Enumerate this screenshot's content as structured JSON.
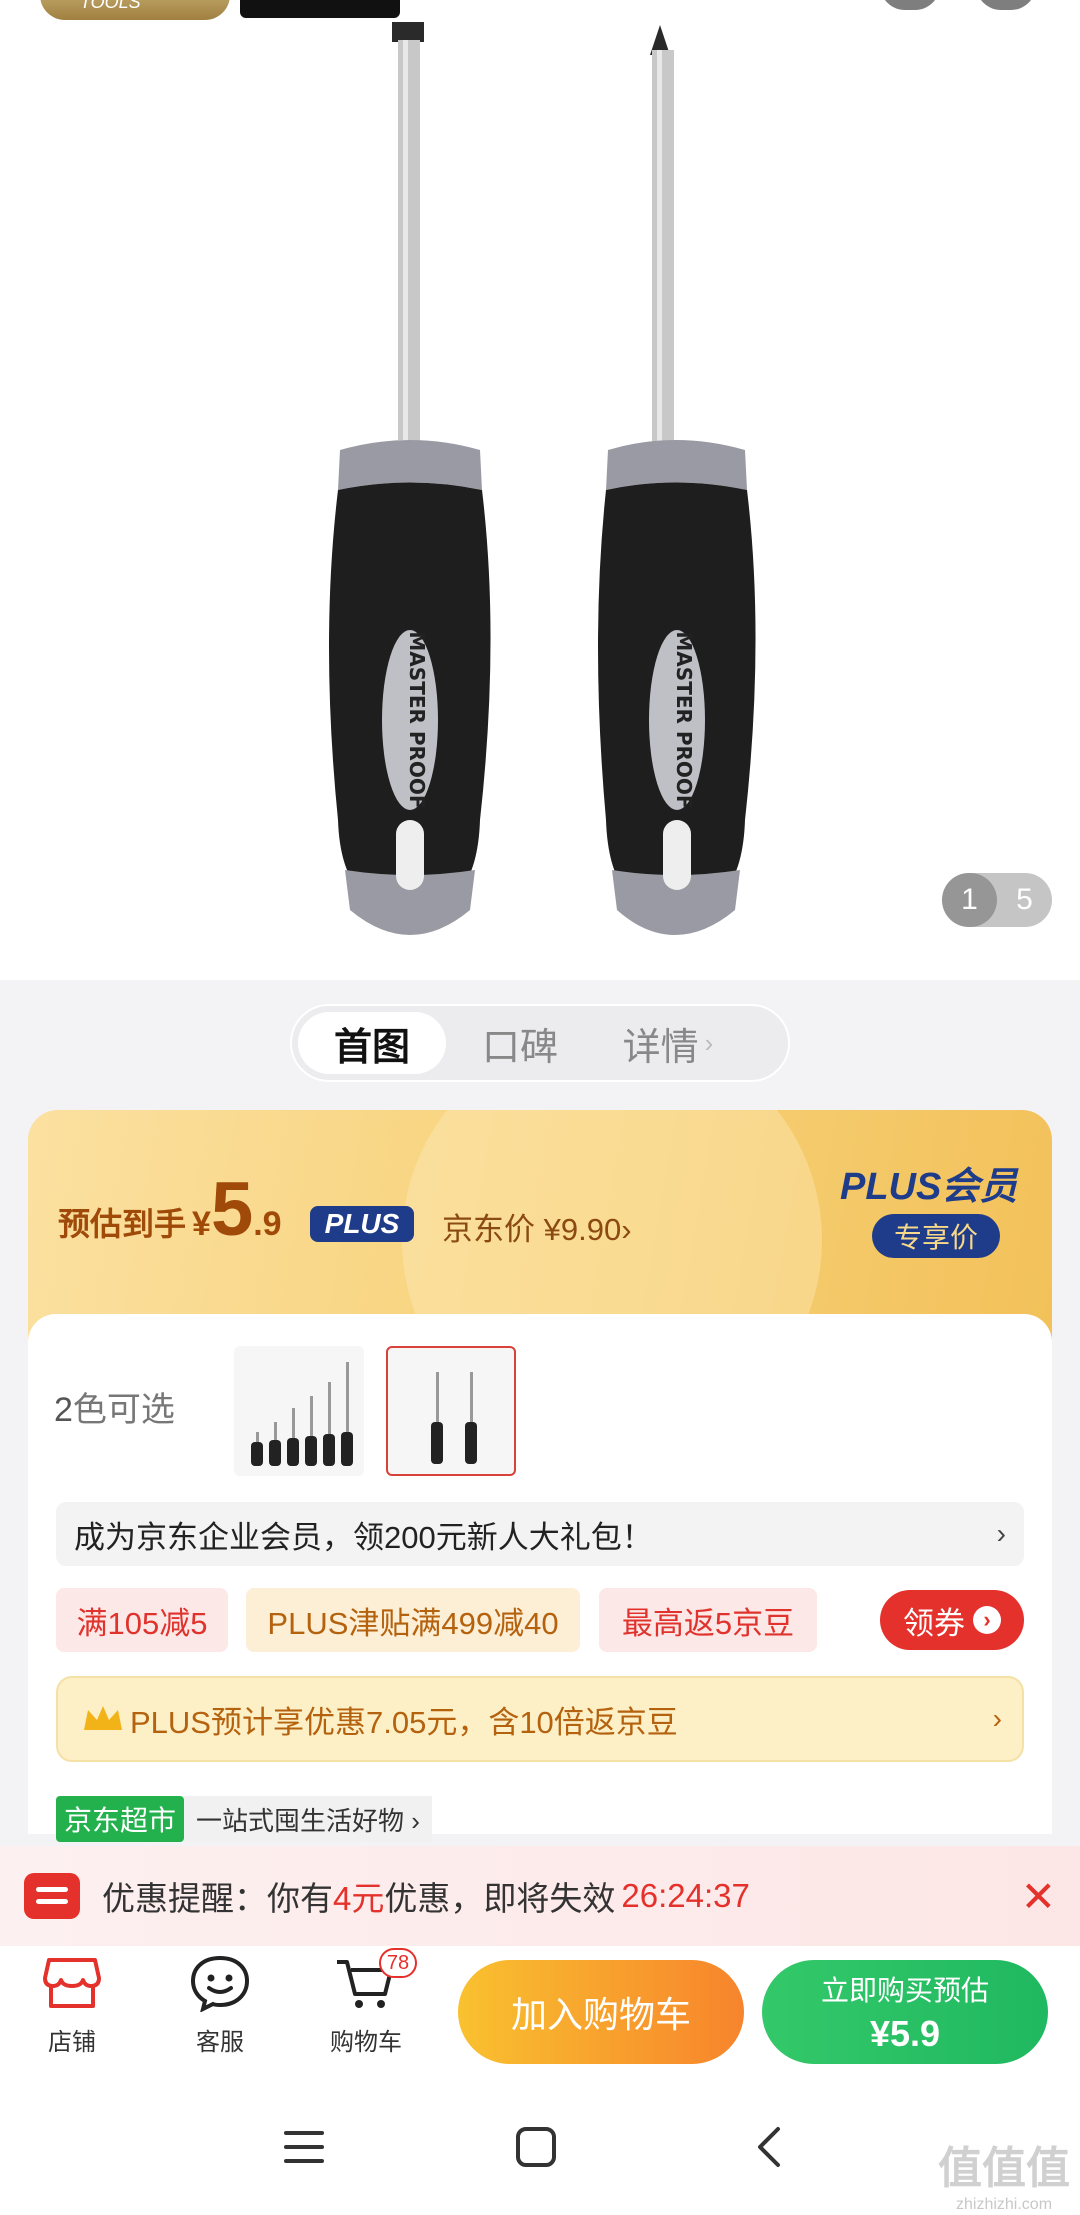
{
  "gallery": {
    "current_page": "1",
    "total_pages": "5",
    "handle_text": "MASTER PROOF"
  },
  "tabs": [
    {
      "label": "首图",
      "active": true
    },
    {
      "label": "口碑",
      "active": false
    },
    {
      "label": "详情",
      "active": false
    }
  ],
  "price": {
    "estimate_label": "预估到手",
    "currency": "¥",
    "integer": "5",
    "decimal": ".9",
    "plus_chip": "PLUS",
    "jd_price": "京东价 ¥9.90›",
    "plus_member_title": "PLUS会员",
    "exclusive_label": "专享价"
  },
  "variants": {
    "label_count": "2",
    "label_text": "色可选"
  },
  "enterprise_banner": {
    "text": "成为京东企业会员，领200元新人大礼包！",
    "arrow": "›"
  },
  "coupons": [
    {
      "text": "满105减5",
      "style": "red"
    },
    {
      "text": "PLUS津贴满499减40",
      "style": "gold"
    },
    {
      "text": "最高返5京豆",
      "style": "red"
    }
  ],
  "coupon_button": {
    "label": "领券",
    "icon": "›"
  },
  "plus_strip": {
    "text": "PLUS预计享优惠7.05元，含10倍返京豆",
    "arrow": "›"
  },
  "market": {
    "tag": "京东超市",
    "text": "一站式囤生活好物 ›"
  },
  "reminder": {
    "prefix": "优惠提醒：你有",
    "amount": "4元",
    "suffix": "优惠，即将失效",
    "countdown": "26:24:37",
    "close": "✕"
  },
  "actionbar": {
    "store": "店铺",
    "service": "客服",
    "cart": "购物车",
    "cart_badge": "78",
    "add_cart": "加入购物车",
    "buy_now": "立即购买预估",
    "buy_price": "¥5.9"
  },
  "watermark": {
    "text": "值值值",
    "domain": "zhizhizhi.com"
  },
  "colors": {
    "accent_red": "#e4312b",
    "plus_navy": "#1f3c8a",
    "buy_green": "#20b860",
    "cart_orange": "#f7842c"
  }
}
